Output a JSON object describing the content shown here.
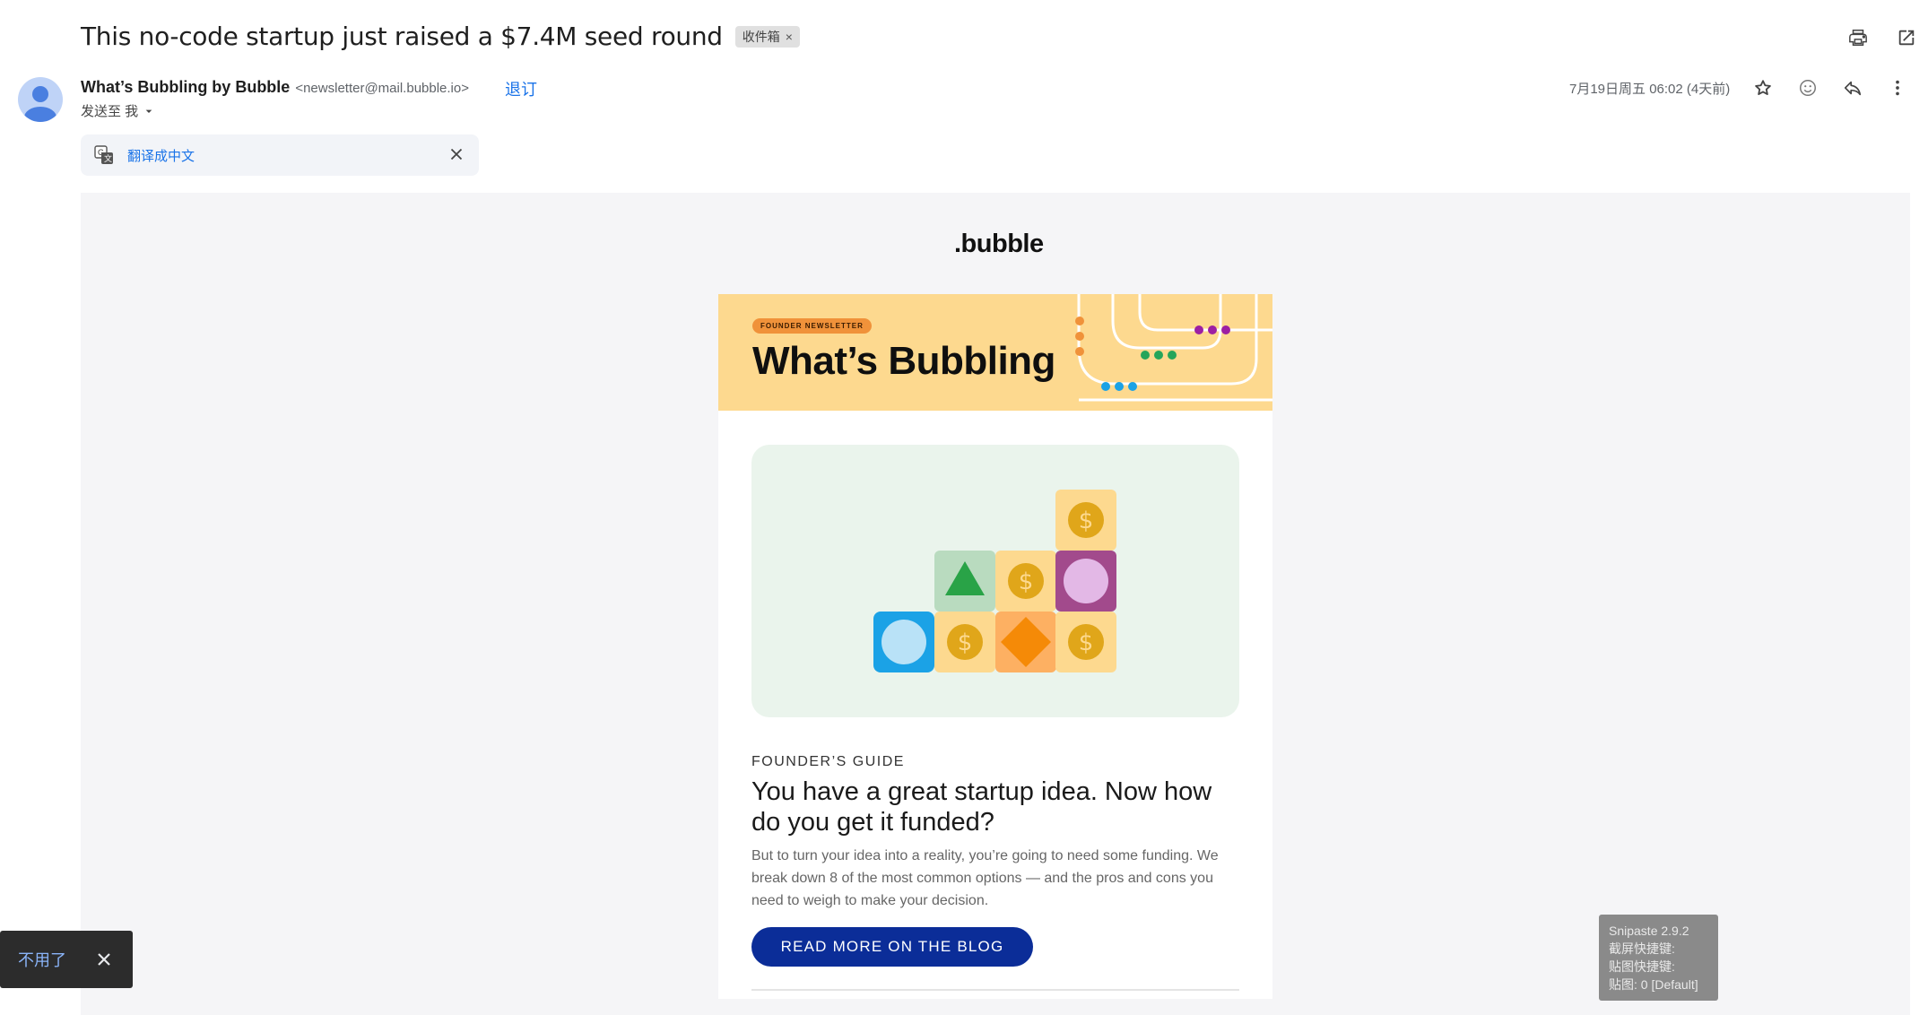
{
  "email": {
    "subject": "This no-code startup just raised a $7.4M seed round",
    "label_chip": "收件箱",
    "label_remove": "×",
    "sender_name": "What’s Bubbling by Bubble",
    "sender_email": "<newsletter@mail.bubble.io>",
    "unsubscribe": "退订",
    "sent_to": "发送至 我",
    "date": "7月19日周五 06:02 (4天前)",
    "translate": "翻译成中文"
  },
  "newsletter": {
    "brand": ".bubble",
    "badge": "FOUNDER NEWSLETTER",
    "title": "What’s Bubbling",
    "eyebrow": "FOUNDER’S GUIDE",
    "headline": "You have a great startup idea. Now how do you get it funded?",
    "paragraph": "But to turn your idea into a reality, you’re going to need some funding. We break down 8 of the most common options — and the pros and cons you need to weigh to make your decision.",
    "cta": "READ MORE ON THE BLOG",
    "dollar_glyph": "$"
  },
  "toast": {
    "label": "不用了"
  },
  "snipaste": {
    "line1": "Snipaste 2.9.2",
    "line2": "截屏快捷键:",
    "line3": "贴图快捷键:",
    "line4": "贴图: 0 [Default]"
  },
  "icons": [
    "print-icon",
    "open-in-new-window-icon",
    "star-icon",
    "emoji-icon",
    "reply-icon",
    "more-vert-icon",
    "translate-icon",
    "close-icon",
    "dropdown-icon",
    "avatar-icon"
  ],
  "colors": {
    "accent": "#1a73e8",
    "hero": "#fdd98f",
    "cta": "#0b2d98",
    "illustration_bg": "#eaf4ec"
  }
}
